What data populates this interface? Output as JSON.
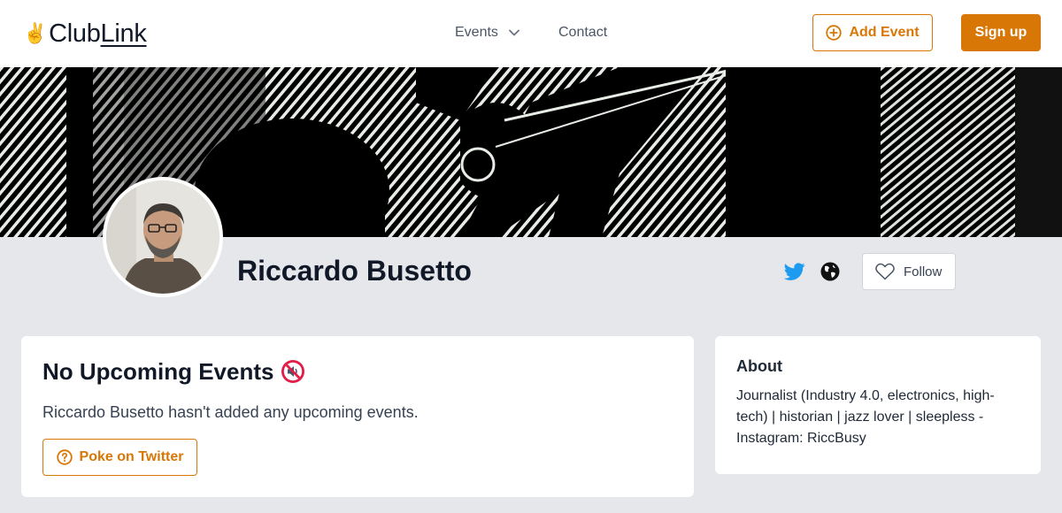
{
  "navbar": {
    "logo_prefix": "Club",
    "logo_suffix": "Link",
    "events_label": "Events",
    "contact_label": "Contact",
    "add_event_label": "Add Event",
    "signup_label": "Sign up"
  },
  "profile": {
    "name": "Riccardo Busetto",
    "follow_label": "Follow",
    "banner_image": "jazz-trumpet-halftone",
    "avatar_image": "profile-photo"
  },
  "events_card": {
    "title": "No Upcoming Events",
    "title_icon": "muted-speaker-icon",
    "message": "Riccardo Busetto hasn't added any upcoming events.",
    "poke_label": "Poke on Twitter"
  },
  "about_card": {
    "title": "About",
    "text": "Journalist (Industry 4.0, electronics, high-tech) | historian | jazz lover | sleepless - Instagram: RiccBusy"
  },
  "colors": {
    "accent": "#d97706",
    "page_bg": "#e5e7eb",
    "twitter": "#1d9bf0"
  }
}
